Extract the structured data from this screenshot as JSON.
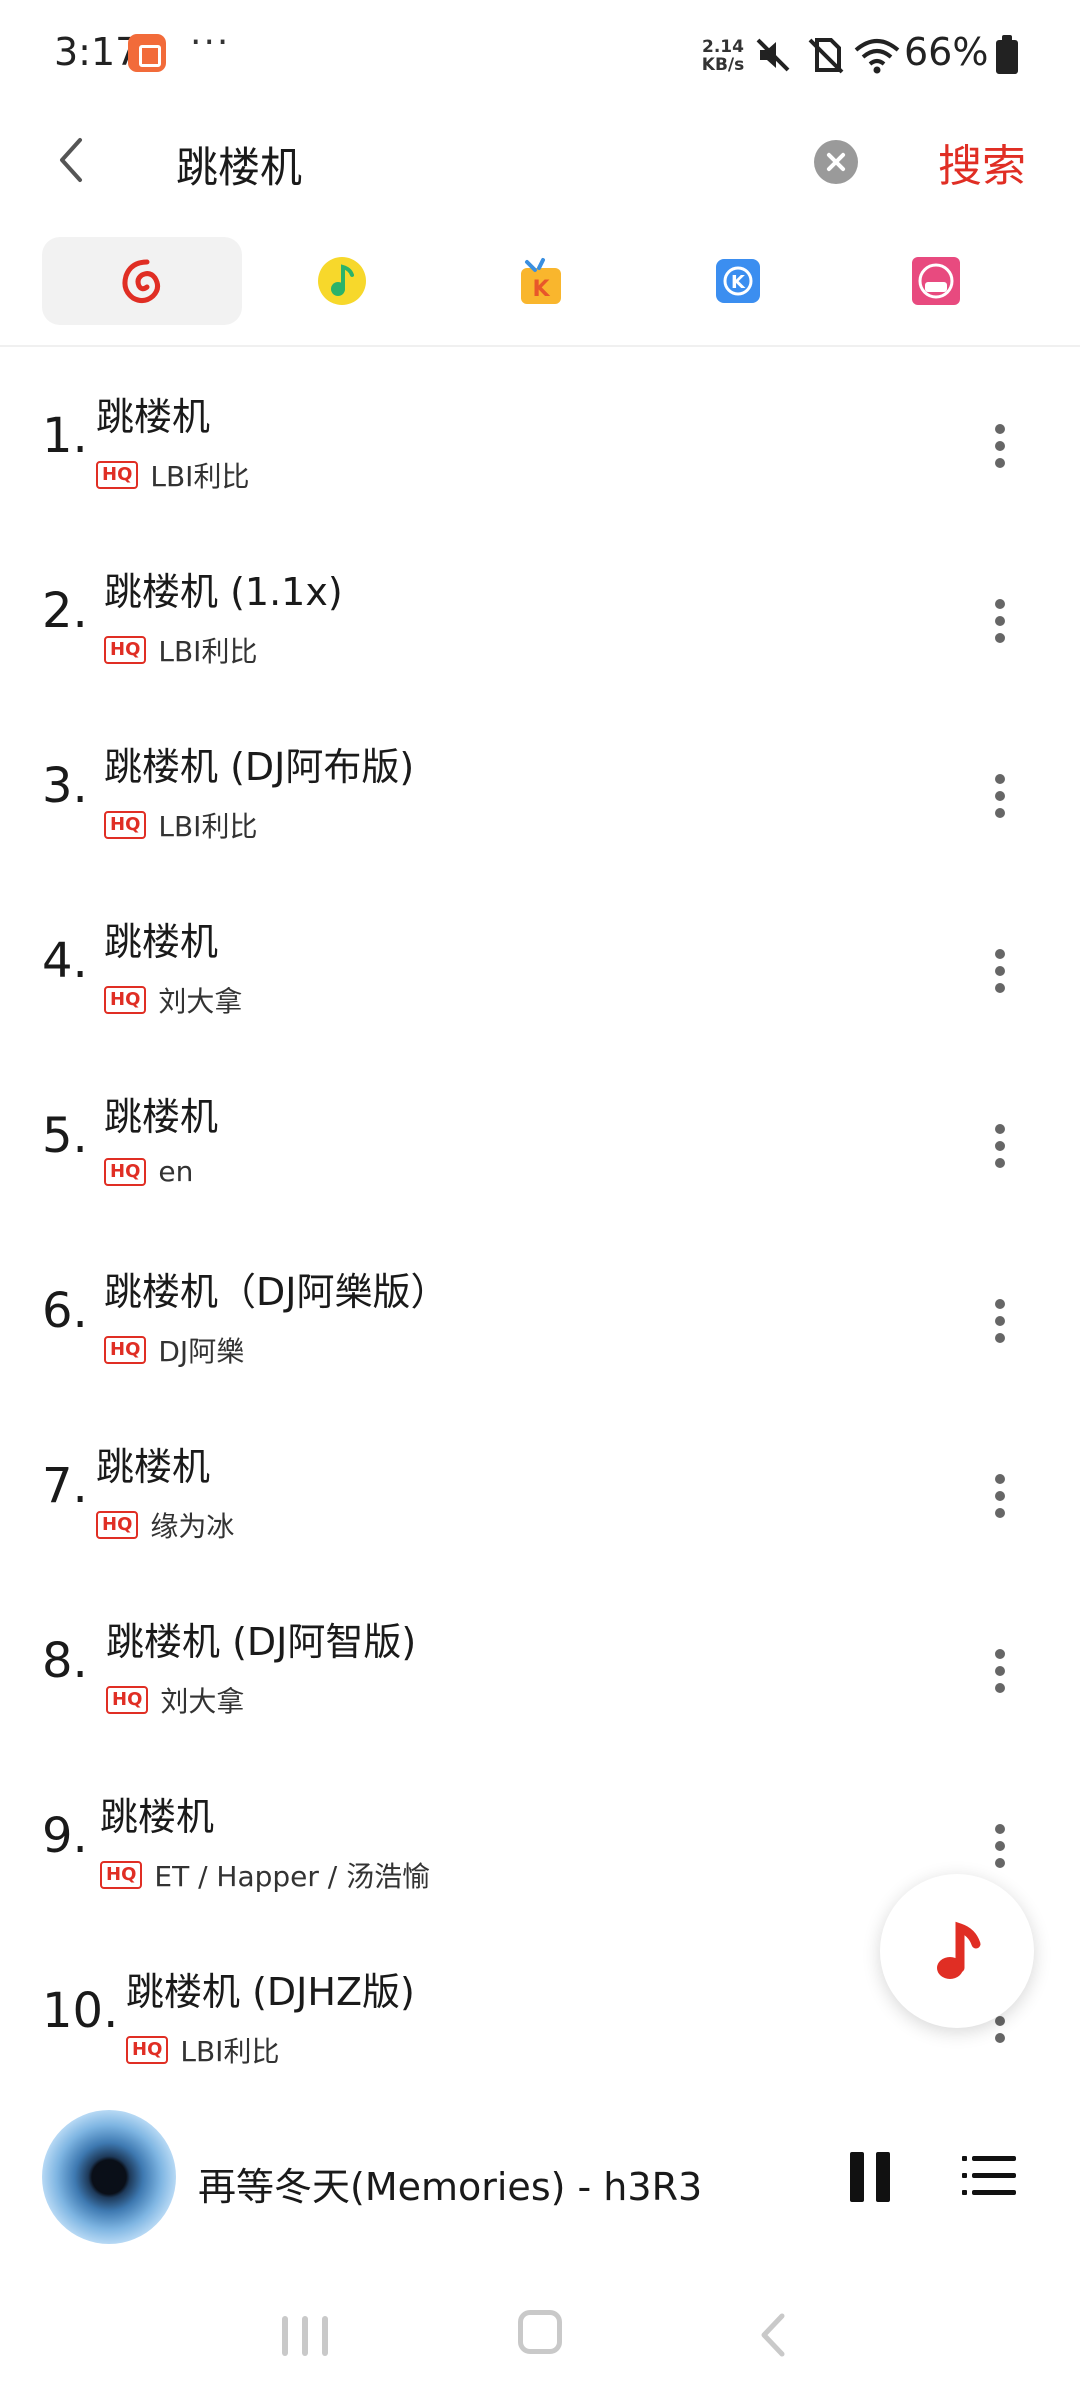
{
  "status_bar": {
    "time": "3:17",
    "more": "···",
    "net_speed_value": "2.14",
    "net_speed_unit": "KB/s",
    "battery": "66%"
  },
  "search": {
    "query": "跳楼机",
    "action_label": "搜索"
  },
  "source_tabs": [
    {
      "name": "netease-cloud-music",
      "active": true
    },
    {
      "name": "qq-music",
      "active": false
    },
    {
      "name": "kuwo-music",
      "active": false
    },
    {
      "name": "kugou-music",
      "active": false
    },
    {
      "name": "migu-music",
      "active": false
    }
  ],
  "songs": [
    {
      "index": "1.",
      "title": "跳楼机",
      "badge": "HQ",
      "artist": "LBI利比"
    },
    {
      "index": "2.",
      "title": "跳楼机 (1.1x)",
      "badge": "HQ",
      "artist": "LBI利比"
    },
    {
      "index": "3.",
      "title": "跳楼机 (DJ阿布版)",
      "badge": "HQ",
      "artist": "LBI利比"
    },
    {
      "index": "4.",
      "title": "跳楼机",
      "badge": "HQ",
      "artist": "刘大拿"
    },
    {
      "index": "5.",
      "title": "跳楼机",
      "badge": "HQ",
      "artist": "en"
    },
    {
      "index": "6.",
      "title": "跳楼机（DJ阿樂版）",
      "badge": "HQ",
      "artist": "DJ阿樂"
    },
    {
      "index": "7.",
      "title": "跳楼机",
      "badge": "HQ",
      "artist": "缘为冰"
    },
    {
      "index": "8.",
      "title": "跳楼机 (DJ阿智版)",
      "badge": "HQ",
      "artist": "刘大拿"
    },
    {
      "index": "9.",
      "title": "跳楼机",
      "badge": "HQ",
      "artist": "ET / Happer / 汤浩愉"
    },
    {
      "index": "10.",
      "title": "跳楼机 (DJHZ版)",
      "badge": "HQ",
      "artist": "LBI利比"
    }
  ],
  "player": {
    "now_playing": "再等冬天(Memories) - h3R3"
  },
  "colors": {
    "accent": "#e02e24",
    "badge": "#e02e24"
  }
}
